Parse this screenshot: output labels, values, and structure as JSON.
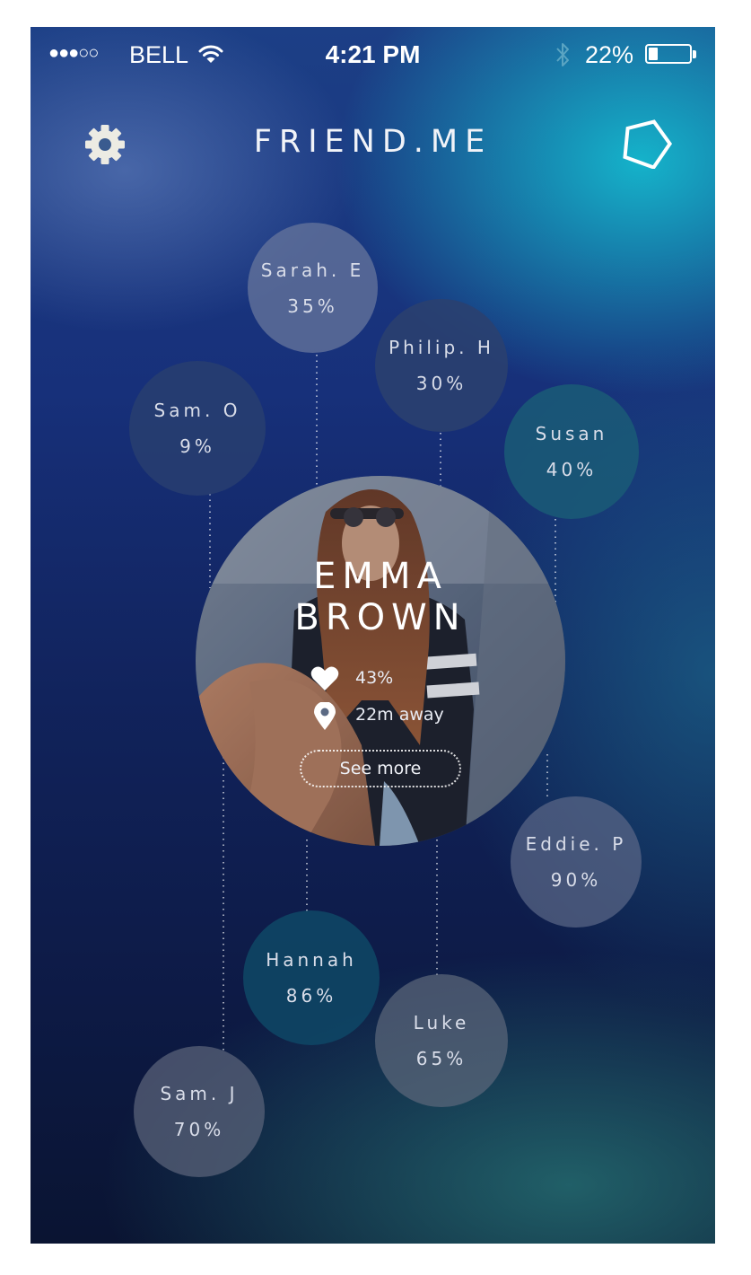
{
  "status_bar": {
    "signal_dots": "●●●○○",
    "carrier": "BELL",
    "time": "4:21 PM",
    "battery_percent": "22%",
    "battery_level": 0.22
  },
  "header": {
    "title": "FRIEND.ME",
    "left_icon": "gear-icon",
    "right_icon": "pentagon-icon"
  },
  "profile": {
    "first_name": "EMMA",
    "last_name": "BROWN",
    "match": "43%",
    "distance": "22m away",
    "see_more": "See more"
  },
  "friends": [
    {
      "name": "Sarah. E",
      "percent": "35%"
    },
    {
      "name": "Philip. H",
      "percent": "30%"
    },
    {
      "name": "Sam. O",
      "percent": "9%"
    },
    {
      "name": "Susan",
      "percent": "40%"
    },
    {
      "name": "Eddie. P",
      "percent": "90%"
    },
    {
      "name": "Hannah",
      "percent": "86%"
    },
    {
      "name": "Luke",
      "percent": "65%"
    },
    {
      "name": "Sam. J",
      "percent": "70%"
    }
  ],
  "colors": {
    "bubble_slate": "#5d6b8f",
    "bubble_blue": "#1f3f6f",
    "bubble_teal": "#1d5a78",
    "accent_cyan": "#14c8d7"
  }
}
